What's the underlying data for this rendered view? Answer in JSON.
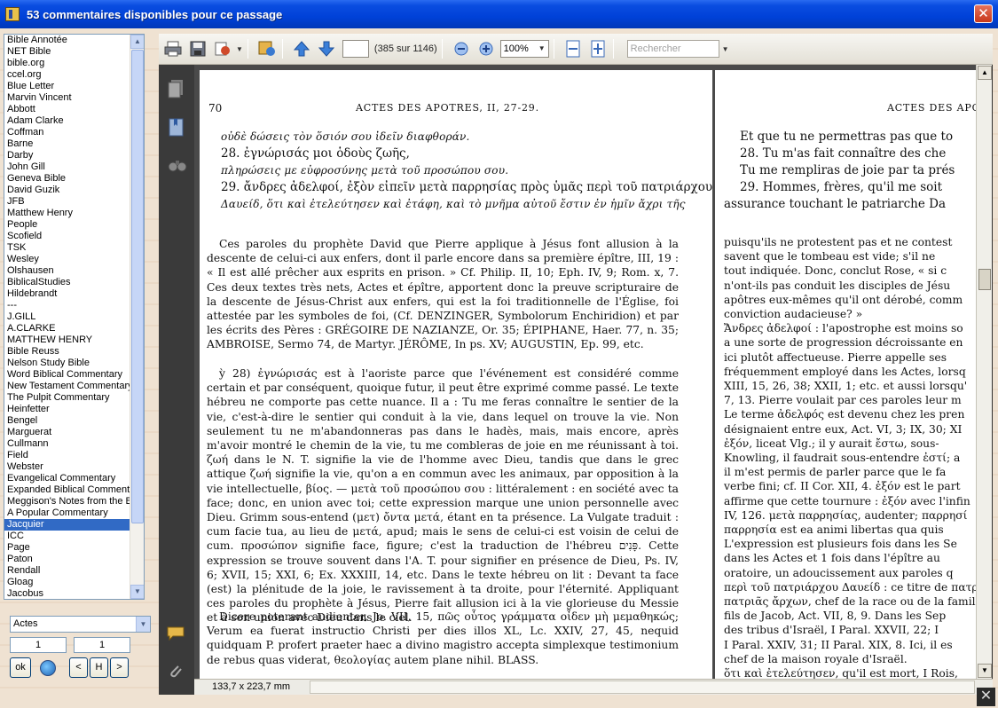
{
  "window": {
    "title": "53 commentaires disponibles pour ce passage",
    "close_label": "✕"
  },
  "commentaries": [
    "Bible Annotée",
    "NET Bible",
    "bible.org",
    "ccel.org",
    "Blue Letter",
    "Marvin Vincent",
    "Abbott",
    "Adam Clarke",
    "Coffman",
    "Barne",
    "Darby",
    "John Gill",
    "Geneva Bible",
    "David Guzik",
    "JFB",
    "Matthew Henry",
    "People",
    "Scofield",
    "TSK",
    "Wesley",
    "Olshausen",
    "BiblicalStudies",
    "Hildebrandt",
    "---",
    "J.GILL",
    "A.CLARKE",
    "MATTHEW HENRY",
    "Bible Reuss",
    "Nelson Study Bible",
    "Word Biblical Commentary",
    "New Testament Commentary",
    "The Pulpit Commentary",
    "Heinfetter",
    "Bengel",
    "Marguerat",
    "Cullmann",
    "Field",
    "Webster",
    "Evangelical Commentary",
    "Expanded Biblical Comments",
    "Meggison's Notes from the Bi",
    "A Popular Commentary",
    "Jacquier",
    "ICC",
    "Page",
    "Paton",
    "Rendall",
    "Gloag",
    "Jacobus"
  ],
  "selected_commentary": "Jacquier",
  "controls": {
    "book": "Actes",
    "chapter": "1",
    "verse": "1",
    "ok_label": "ok",
    "prev_label": "<",
    "h_label": "H",
    "next_label": ">"
  },
  "toolbar": {
    "page_input": "",
    "page_count": "(385 sur 1146)",
    "zoom": "100%",
    "search_placeholder": "Rechercher"
  },
  "status": {
    "dimensions": "133,7 x 223,7 mm"
  },
  "page1": {
    "number": "70",
    "header": "ACTES DES APOTRES, II, 27-29.",
    "greek1": "οὐδὲ δώσεις τὸν ὅσιόν σου ἰδεῖν διαφθοράν.",
    "verse28": "28. ἐγνώρισάς μοι ὁδοὺς ζωῆς,",
    "greek2": "πληρώσεις με εὐφροσύνης μετὰ τοῦ προσώπου σου.",
    "verse29a": "29. ἄνδρες ἀδελφοί, ἐξὸν εἰπεῖν μετὰ παρρησίας πρὸς ὑμᾶς περὶ τοῦ πατριάρχου",
    "verse29b": "Δαυείδ, ὅτι καὶ ἐτελεύτησεν καὶ ἐτάφη, καὶ τὸ μνῆμα αὐτοῦ ἔστιν ἐν ἡμῖν ἄχρι τῆς",
    "para1": "Ces paroles du prophète David que Pierre applique à Jésus font allusion à la descente de celui-ci aux enfers, dont il parle encore dans sa première épître, III, 19 : « Il est allé prêcher aux esprits en prison. » Cf. Philip. II, 10; Eph. IV, 9; Rom. x, 7. Ces deux textes très nets, Actes et épître, apportent donc la preuve scripturaire de la descente de Jésus-Christ aux enfers, qui est la foi traditionnelle de l'Église, foi attestée par les symboles de foi, (Cf. DENZINGER, Symbolorum Enchiridion) et par les écrits des Pères : GRÉGOIRE DE NAZIANZE, Or. 35; ÉPIPHANE, Haer. 77, n. 35; AMBROISE, Sermo 74, de Martyr. JÉRÔME, In ps. XV; AUGUSTIN, Ep. 99, etc.",
    "para2": "ỳ 28) ἐγνώρισάς est à l'aoriste parce que l'événement est considéré comme certain et par conséquent, quoique futur, il peut être exprimé comme passé. Le texte hébreu ne comporte pas cette nuance. Il a : Tu me feras connaître le sentier de la vie, c'est-à-dire le sentier qui conduit à la vie, dans lequel on trouve la vie. Non seulement tu ne m'abandonneras pas dans le hadès, mais, mais encore, après m'avoir montré le chemin de la vie, tu me combleras de joie en me réunissant à toi. ζωή dans le N. T. signifie la vie de l'homme avec Dieu, tandis que dans le grec attique ζωή signifie la vie, qu'on a en commun avec les animaux, par opposition à la vie intellectuelle, βίος. — μετὰ τοῦ προσώπου σου : littéralement : en société avec ta face; donc, en union avec toi; cette expression marque une union personnelle avec Dieu. Grimm sous-entend (μετ) ὄντα μετά, étant en ta présence. La Vulgate traduit : cum facie tua, au lieu de μετά, apud; mais le sens de celui-ci est voisin de celui de cum. προσώπον signifie face, figure; c'est la traduction de l'hébreu פָּנִים. Cette expression se trouve souvent dans l'A. T. pour signifier en présence de Dieu, Ps. IV, 6; XVII, 15; XXI, 6; Ex. XXXIII, 14, etc. Dans le texte hébreu on lit : Devant ta face (est) la plénitude de la joie, le ravissement à ta droite, pour l'éternité. Appliquant ces paroles du prophète à Jésus, Pierre fait allusion ici à la vie glorieuse du Messie et à son union avec Dieu dans le ciel.",
    "para3": "Dicere poterant audienter, Jo. VII, 15, πῶς οὗτος γράμματα οἶδεν μὴ μεμαθηκώς; Verum ea fuerat instructio Christi per dies illos XL, Lc. XXIV, 27, 45, nequid quidquam P. profert praeter haec a divino magistro accepta simplexque testimonium de rebus quas viderat, θεολογίας autem plane nihil. BLASS."
  },
  "page2": {
    "header": "ACTES DES APO",
    "l1": "Et que tu ne permettras pas que to",
    "l2": "28. Tu m'as fait connaître des che",
    "l3": "Tu me rempliras de joie par ta prés",
    "l4": "29. Hommes, frères, qu'il me soit",
    "l5": "assurance touchant le patriarche Da",
    "body": [
      "puisqu'ils ne protestent pas et ne contest",
      "savent que le tombeau est vide; s'il ne",
      "tout indiquée. Donc, conclut Rose, « si c",
      "n'ont-ils pas conduit les disciples de Jésu",
      "apôtres eux-mêmes qu'il ont dérobé, comm",
      "conviction audacieuse? »",
      "Ἄνδρες ἀδελφοί : l'apostrophe est moins so",
      "a une sorte de progression décroissante en",
      "ici plutôt affectueuse. Pierre appelle ses",
      "fréquemment employé dans les Actes, lorsq",
      "XIII, 15, 26, 38; XXII, 1; etc. et aussi lorsqu'",
      "7, 13. Pierre voulait par ces paroles leur m",
      "Le terme ἀδελφός est devenu chez les pren",
      "désignaient entre eux, Act. VI, 3; IX, 30; XI",
      "ἐξόν, liceat Vlg.; il y aurait ἔστω, sous-",
      "Knowling, il faudrait sous-entendre ἐστί; a",
      "il m'est permis de parler parce que le fa",
      "verbe fini; cf. II Cor. XII, 4. ἐξόν est le part",
      "affirme que cette tournure : ἐξόν avec l'infin",
      "IV, 126. μετὰ παρρησίας, audenter; παρρησί",
      "παρρησία est ea animi libertas qua quis",
      "L'expression est plusieurs fois dans les Se",
      "dans les Actes et 1 fois dans l'épître au",
      "oratoire, un adoucissement aux paroles q",
      "περὶ τοῦ πατριάρχου Δαυείδ : ce titre de πατρι",
      "πατριᾶς ἄρχων, chef de la race ou de la famill",
      "fils de Jacob, Act. VII, 8, 9. Dans les Sep",
      "des tribus d'Israël, I Paral. XXVII, 22; I",
      "I Paral. XXIV, 31; II Paral. XIX, 8. Ici, il es",
      "chef de la maison royale d'Israël.",
      "ὅτι καὶ ἐτελεύτησεν, qu'il est mort, I Rois,"
    ]
  }
}
